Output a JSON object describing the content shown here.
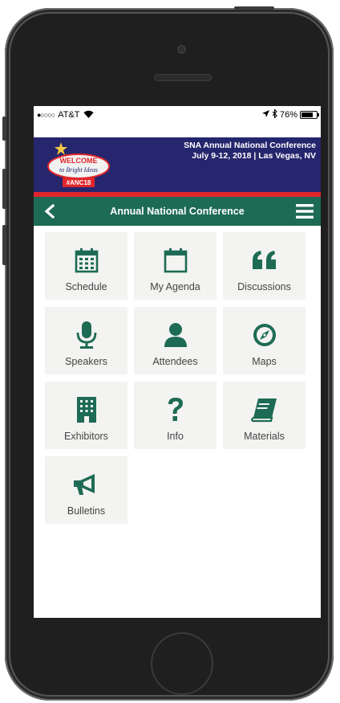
{
  "status_bar": {
    "carrier": "AT&T",
    "battery": "76%"
  },
  "banner": {
    "logo_welcome": "WELCOME",
    "logo_tagline": "to Bright Ideas",
    "logo_hashtag": "#ANC18",
    "title": "SNA Annual National Conference",
    "subtitle": "July 9-12, 2018 | Las Vegas, NV"
  },
  "navbar": {
    "title": "Annual National Conference",
    "back_icon": "chevron-left-icon",
    "menu_icon": "hamburger-icon"
  },
  "tiles": [
    {
      "label": "Schedule",
      "icon": "calendar-grid-icon"
    },
    {
      "label": "My Agenda",
      "icon": "calendar-empty-icon"
    },
    {
      "label": "Discussions",
      "icon": "quote-icon"
    },
    {
      "label": "Speakers",
      "icon": "microphone-icon"
    },
    {
      "label": "Attendees",
      "icon": "user-icon"
    },
    {
      "label": "Maps",
      "icon": "compass-icon"
    },
    {
      "label": "Exhibitors",
      "icon": "building-icon"
    },
    {
      "label": "Info",
      "icon": "question-icon"
    },
    {
      "label": "Materials",
      "icon": "book-icon"
    },
    {
      "label": "Bulletins",
      "icon": "megaphone-icon"
    }
  ],
  "colors": {
    "banner_bg": "#26266e",
    "banner_stripe": "#e0262b",
    "nav_green": "#1d6b54",
    "tile_bg": "#f3f3f1",
    "icon_green": "#1d6b54"
  }
}
